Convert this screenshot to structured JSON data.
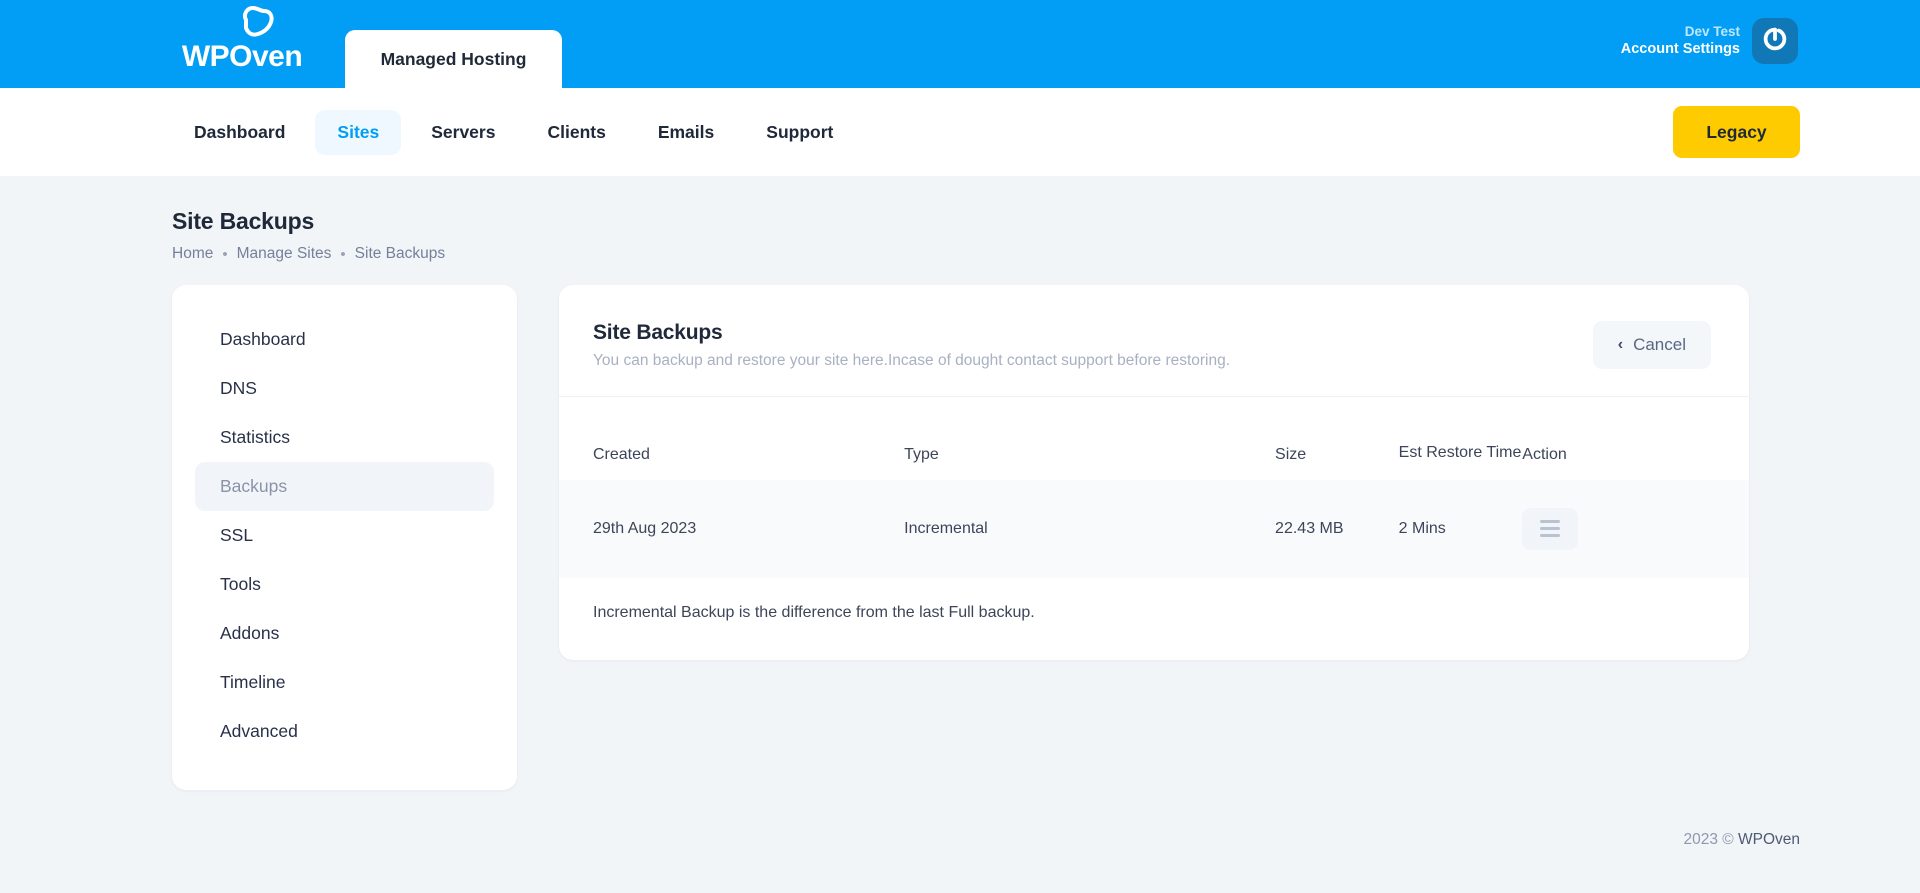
{
  "topbar": {
    "logo_text": "WPOven",
    "logo_mark_icon": "oven-loaf-icon",
    "tab_label": "Managed Hosting",
    "account_name": "Dev Test",
    "account_settings_label": "Account Settings",
    "avatar_icon": "power-button-icon",
    "bg_color": "#029ef5"
  },
  "navbar": {
    "items": [
      {
        "label": "Dashboard",
        "active": false
      },
      {
        "label": "Sites",
        "active": true
      },
      {
        "label": "Servers",
        "active": false
      },
      {
        "label": "Clients",
        "active": false
      },
      {
        "label": "Emails",
        "active": false
      },
      {
        "label": "Support",
        "active": false
      }
    ],
    "legacy_button": "Legacy",
    "legacy_color": "#fecb00",
    "active_color": "#029ef5"
  },
  "page": {
    "title": "Site Backups",
    "breadcrumb": [
      "Home",
      "Manage Sites",
      "Site Backups"
    ],
    "breadcrumb_separator": "•"
  },
  "sidebar": {
    "items": [
      {
        "label": "Dashboard",
        "active": false
      },
      {
        "label": "DNS",
        "active": false
      },
      {
        "label": "Statistics",
        "active": false
      },
      {
        "label": "Backups",
        "active": true
      },
      {
        "label": "SSL",
        "active": false
      },
      {
        "label": "Tools",
        "active": false
      },
      {
        "label": "Addons",
        "active": false
      },
      {
        "label": "Timeline",
        "active": false
      },
      {
        "label": "Advanced",
        "active": false
      }
    ]
  },
  "main": {
    "title": "Site Backups",
    "subtitle": "You can backup and restore your site here.Incase of dought contact support before restoring.",
    "cancel_label": "Cancel",
    "cancel_chevron": "‹",
    "table": {
      "headers": [
        "Created",
        "Type",
        "Size",
        "Est Restore Time",
        "Action"
      ],
      "rows": [
        {
          "created": "29th Aug 2023",
          "type": "Incremental",
          "size": "22.43 MB",
          "est_restore_time": "2 Mins",
          "action_icon": "hamburger-menu-icon"
        }
      ]
    },
    "note": "Incremental Backup is the difference from the last Full backup."
  },
  "footer": {
    "year_copy": "2023 ©",
    "brand": "WPOven"
  }
}
